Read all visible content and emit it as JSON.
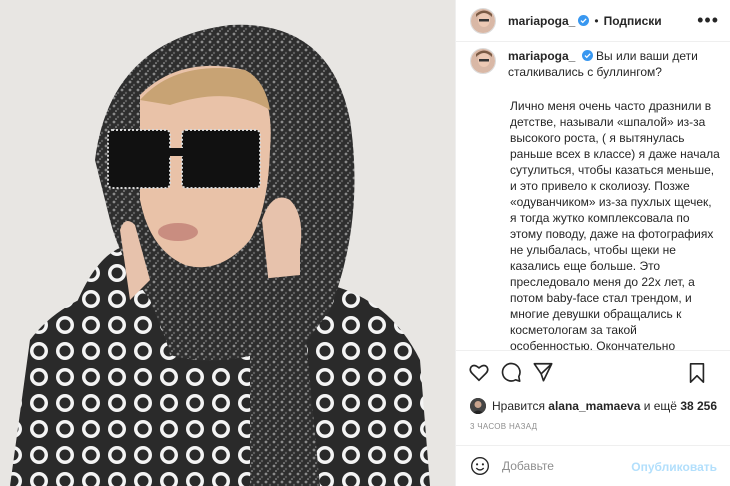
{
  "post": {
    "username": "mariapoga_",
    "separator": "•",
    "follow_label": "Подписки",
    "more_label": "•••"
  },
  "caption": {
    "username": "mariapoga_",
    "headline": "Вы или ваши дети сталкивались с буллингом?",
    "body": "Лично меня очень часто дразнили в детстве, называли «шпалой» из-за высокого роста, ( я вытянулась раньше всех в классе) я даже начала сутулиться, чтобы казаться меньше, и это привело к сколиозу. Позже «одуванчиком» из-за пухлых щечек, я тогда жутко комплексовала по этому поводу, даже на фотографиях не улыбалась, чтобы щеки не казались еще больше. Это преследовало меня до 22х лет, а потом baby-face стал трендом, и многие девушки обращались к косметологам за такой особенностью. Окончательно комплекс прошел после переезда в"
  },
  "likes": {
    "prefix": "Нравится",
    "user": "alana_mamaeva",
    "conj": "и ещё",
    "count": "38 256"
  },
  "time_ago": "3 часов назад",
  "comment": {
    "placeholder": "Добавьте",
    "publish_label": "Опубликовать"
  },
  "icons": {
    "verified": "verified-badge-icon",
    "like": "heart-icon",
    "comment": "comment-bubble-icon",
    "share": "paper-plane-icon",
    "save": "bookmark-icon",
    "emoji": "smiley-icon",
    "more": "ellipsis-icon"
  },
  "colors": {
    "verified_blue": "#3897f0",
    "publish_disabled": "#b2dffc",
    "meta_gray": "#8e8e8e"
  }
}
